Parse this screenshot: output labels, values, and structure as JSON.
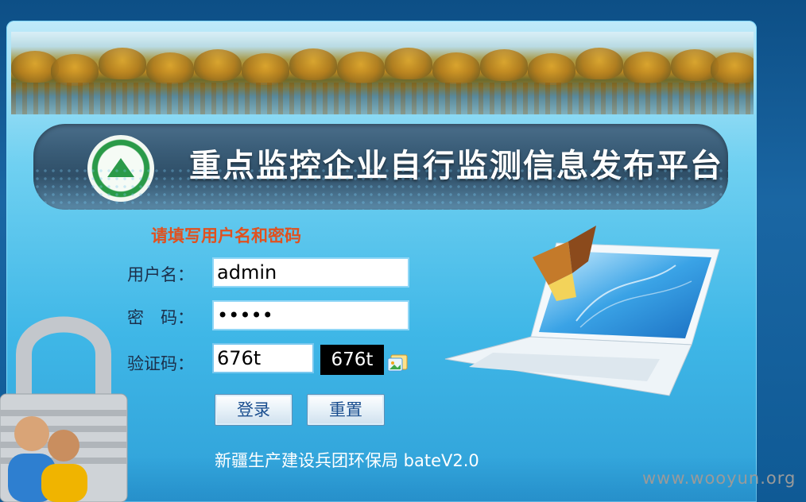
{
  "header": {
    "title": "重点监控企业自行监测信息发布平台",
    "emblem_icon": "environmental-protection-emblem-icon"
  },
  "login": {
    "prompt": "请填写用户名和密码",
    "username_label": "用户名：",
    "username_value": "admin",
    "password_label": "密　码：",
    "password_value": "•••••",
    "captcha_label": "验证码：",
    "captcha_value": "676t",
    "captcha_image_text": "676t",
    "refresh_icon": "refresh-captcha-icon",
    "login_button": "登录",
    "reset_button": "重置"
  },
  "footer": {
    "org": "新疆生产建设兵团环保局 bateV2.0"
  },
  "watermark": "www.wooyun.org",
  "colors": {
    "prompt": "#e0511f",
    "panel": "#3fb7e7",
    "title_bar": "#3a5d78"
  }
}
